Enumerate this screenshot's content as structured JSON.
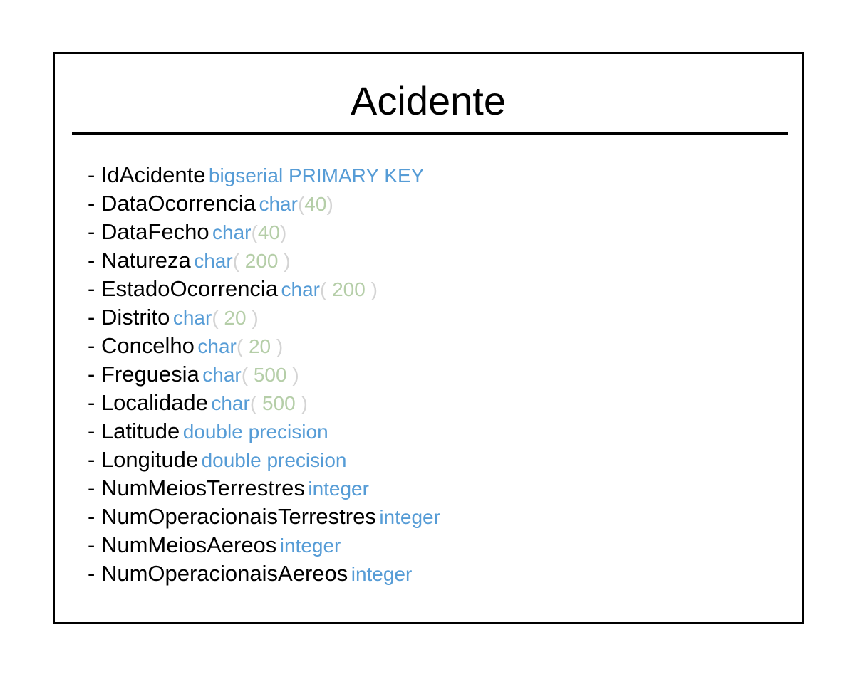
{
  "entity": {
    "title": "Acidente",
    "attributes": [
      {
        "prefix": "- ",
        "name": "IdAcidente",
        "type": "bigserial PRIMARY KEY",
        "length": ""
      },
      {
        "prefix": "- ",
        "name": "DataOcorrencia",
        "type": "char",
        "length": "(40)"
      },
      {
        "prefix": "- ",
        "name": "DataFecho",
        "type": "char",
        "length": "(40)"
      },
      {
        "prefix": "- ",
        "name": "Natureza",
        "type": "char",
        "length": "( 200 )"
      },
      {
        "prefix": "- ",
        "name": "EstadoOcorrencia",
        "type": "char",
        "length": "( 200 )"
      },
      {
        "prefix": "- ",
        "name": "Distrito",
        "type": "char",
        "length": "( 20 )"
      },
      {
        "prefix": "- ",
        "name": "Concelho",
        "type": "char",
        "length": "( 20 )"
      },
      {
        "prefix": "- ",
        "name": "Freguesia",
        "type": "char",
        "length": "( 500 )"
      },
      {
        "prefix": "- ",
        "name": "Localidade",
        "type": "char",
        "length": "( 500 )"
      },
      {
        "prefix": "- ",
        "name": "Latitude",
        "type": "double precision",
        "length": ""
      },
      {
        "prefix": "- ",
        "name": "Longitude",
        "type": "double precision",
        "length": ""
      },
      {
        "prefix": "- ",
        "name": "NumMeiosTerrestres",
        "type": "integer",
        "length": ""
      },
      {
        "prefix": "- ",
        "name": "NumOperacionaisTerrestres",
        "type": "integer",
        "length": ""
      },
      {
        "prefix": "- ",
        "name": "NumMeiosAereos",
        "type": "integer",
        "length": ""
      },
      {
        "prefix": "- ",
        "name": "NumOperacionaisAereos",
        "type": "integer",
        "length": ""
      }
    ]
  },
  "colors": {
    "type": "#569cd6",
    "length_digits": "#b5cea8",
    "length_parens": "#d4d4d4",
    "name": "#000000",
    "border": "#000000"
  }
}
